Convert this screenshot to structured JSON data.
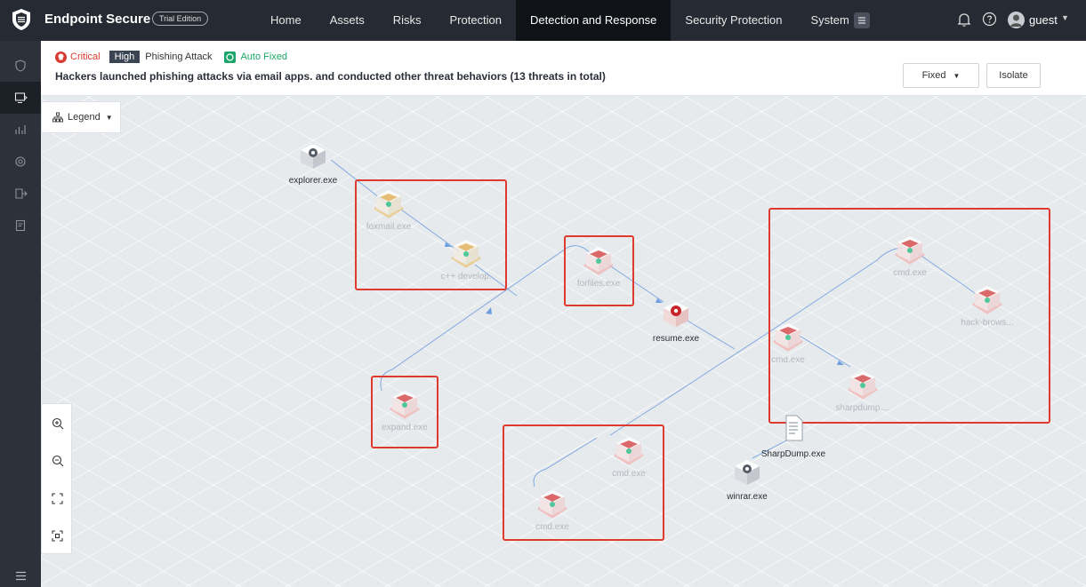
{
  "app": {
    "title": "Endpoint Secure",
    "edition": "Trial Edition"
  },
  "nav": {
    "items": [
      "Home",
      "Assets",
      "Risks",
      "Protection",
      "Detection and Response",
      "Security Protection",
      "System"
    ],
    "active": "Detection and Response"
  },
  "user": {
    "name": "guest"
  },
  "icons": {
    "logo": "shield-logo-icon",
    "nav_menu": "list-menu-icon",
    "notifications": "bell-icon",
    "help": "question-icon",
    "avatar": "user-avatar-icon",
    "sidebar": [
      "shield-icon",
      "monitor-response-icon",
      "chart-icon",
      "target-icon",
      "export-icon",
      "report-icon"
    ],
    "sidebar_bottom": "collapse-menu-icon",
    "legend": "hierarchy-icon",
    "zoom": [
      "zoom-in-icon",
      "zoom-out-icon",
      "fit-screen-icon",
      "center-focus-icon"
    ]
  },
  "incident": {
    "severity": "Critical",
    "level": "High",
    "type": "Phishing Attack",
    "status": "Auto Fixed",
    "summary": "Hackers launched phishing attacks via email apps. and conducted other threat behaviors (13 threats in total)",
    "actions": {
      "fixed_label": "Fixed",
      "isolate_label": "Isolate"
    }
  },
  "graph": {
    "legend_label": "Legend",
    "nodes": [
      {
        "id": "explorer",
        "label": "explorer.exe",
        "kind": "gear",
        "dim": false
      },
      {
        "id": "foxmail",
        "label": "foxmail.exe",
        "kind": "mail-yellow",
        "dim": true
      },
      {
        "id": "cpp",
        "label": "c++ develop.",
        "kind": "mail-yellow",
        "dim": true
      },
      {
        "id": "forfiles",
        "label": "forfiles.exe",
        "kind": "mail-red",
        "dim": true
      },
      {
        "id": "resume",
        "label": "resume.exe",
        "kind": "gear-red",
        "dim": false
      },
      {
        "id": "expand",
        "label": "expand.exe",
        "kind": "mail-red",
        "dim": true
      },
      {
        "id": "cmd1",
        "label": "cmd.exe",
        "kind": "mail-red",
        "dim": true
      },
      {
        "id": "cmd2",
        "label": "cmd.exe",
        "kind": "mail-red",
        "dim": true
      },
      {
        "id": "cmd3",
        "label": "cmd.exe",
        "kind": "mail-red",
        "dim": true
      },
      {
        "id": "cmd4",
        "label": "cmd.exe",
        "kind": "mail-red",
        "dim": true
      },
      {
        "id": "hackbrowser",
        "label": "hack-brows...",
        "kind": "mail-red",
        "dim": true
      },
      {
        "id": "sharpdump1",
        "label": "sharpdump....",
        "kind": "mail-red",
        "dim": true
      },
      {
        "id": "sharpdump2",
        "label": "SharpDump.exe",
        "kind": "file",
        "dim": false
      },
      {
        "id": "winrar",
        "label": "winrar.exe",
        "kind": "gear",
        "dim": false
      }
    ]
  },
  "colors": {
    "topbar": "#262b33",
    "critical": "#d83a2f",
    "auto_fixed": "#1aa66b",
    "highlight": "#e03a2e",
    "edge": "#6d9ede"
  }
}
